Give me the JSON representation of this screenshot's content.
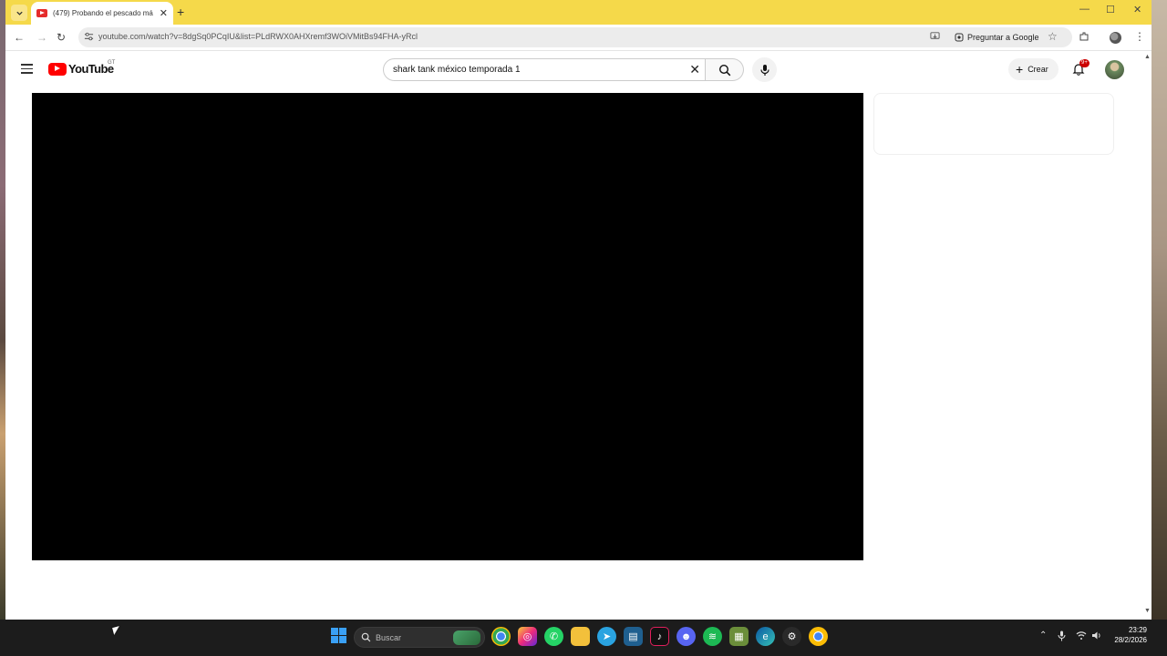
{
  "browser": {
    "tab_title": "(479) Probando el pescado má",
    "new_tab_glyph": "+",
    "close_glyph": "✕",
    "url": "youtube.com/watch?v=8dgSq0PCqIU&list=PLdRWX0AHXremf3WOiVMitBs94FHA-yRcl",
    "ask_google_label": "Preguntar a Google",
    "window_controls": {
      "minimize": "—",
      "maximize": "☐",
      "close": "✕"
    },
    "nav": {
      "back": "←",
      "forward": "→",
      "reload": "↻",
      "menu": "⋮"
    }
  },
  "youtube": {
    "logo_text": "YouTube",
    "country_code": "GT",
    "search_query": "shark tank méxico temporada 1",
    "create_label": "Crear",
    "notifications_badge": "9+",
    "accent_color": "#ff0000"
  },
  "taskbar": {
    "search_placeholder": "Buscar",
    "clock_time": "23:29",
    "clock_date": "28/2/2026",
    "icons": [
      "chrome-icon",
      "instagram-icon",
      "whatsapp-icon",
      "file-explorer-icon",
      "telegram-icon",
      "store-icon",
      "tiktok-icon",
      "discord-icon",
      "spotify-icon",
      "minecraft-icon",
      "edge-icon",
      "steam-icon",
      "chrome-canary-icon"
    ],
    "instagram_badge": "9",
    "discord_badge": "9"
  }
}
